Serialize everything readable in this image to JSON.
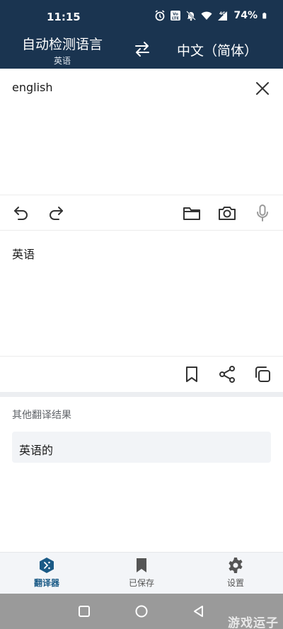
{
  "status_bar": {
    "time": "11:15",
    "battery": "74%",
    "icons": [
      "alarm-icon",
      "volte-icon",
      "mute-icon",
      "wifi-icon",
      "signal-4g-icon",
      "battery-icon"
    ]
  },
  "header": {
    "source_language": "自动检测语言",
    "detected_language": "英语",
    "target_language": "中文（简体）",
    "swap_icon": "swap-arrows-icon",
    "background_color": "#1a3450"
  },
  "input": {
    "text": "english",
    "clear_icon": "close-icon",
    "tools": [
      "undo-icon",
      "redo-icon",
      "folder-icon",
      "camera-icon",
      "microphone-icon"
    ]
  },
  "output": {
    "text": "英语",
    "tools": [
      "bookmark-icon",
      "share-icon",
      "copy-icon"
    ]
  },
  "alternatives": {
    "title": "其他翻译结果",
    "items": [
      "英语的"
    ]
  },
  "bottom_nav": {
    "items": [
      {
        "label": "翻译器",
        "icon": "translator-icon",
        "active": true
      },
      {
        "label": "已保存",
        "icon": "bookmark-filled-icon",
        "active": false
      },
      {
        "label": "设置",
        "icon": "gear-icon",
        "active": false
      }
    ],
    "accent_color": "#1a5a86"
  },
  "system_nav": {
    "buttons": [
      "recents-square-icon",
      "home-circle-icon",
      "back-triangle-icon"
    ]
  },
  "watermark": "游戏运子"
}
